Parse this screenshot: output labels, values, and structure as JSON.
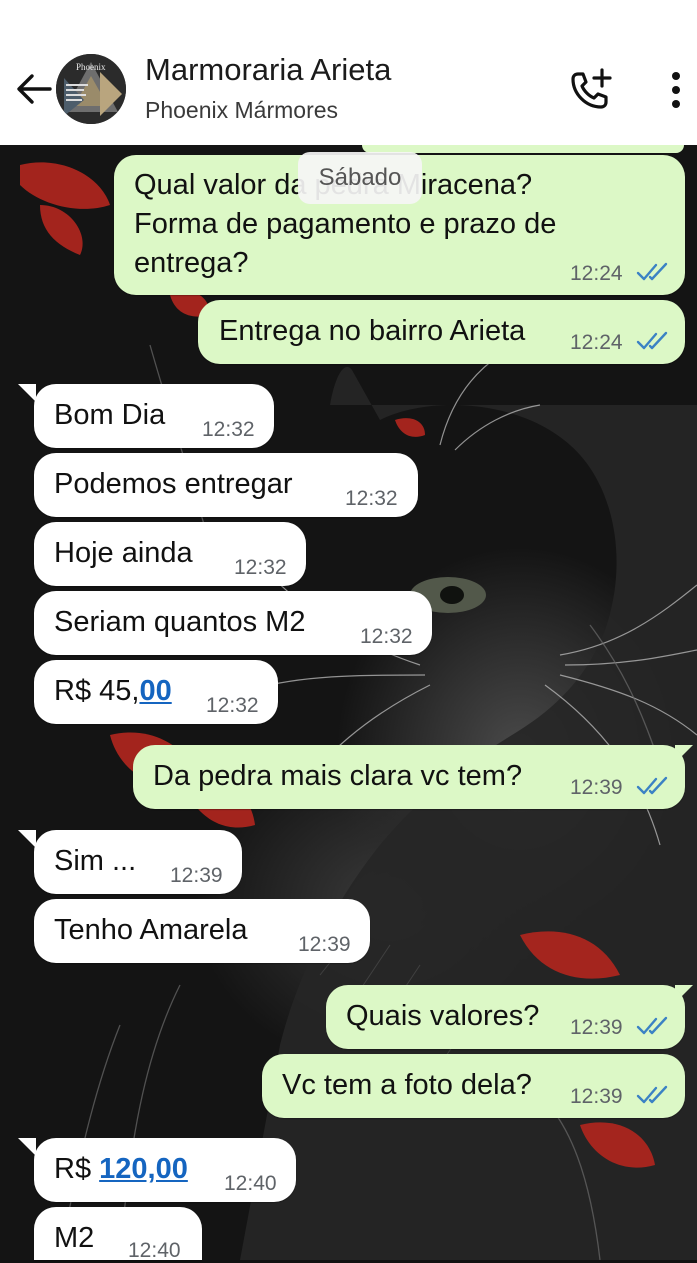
{
  "header": {
    "title": "Marmoraria Arieta",
    "subtitle": "Phoenix Mármores",
    "avatar_text": "Phoenix",
    "icons": {
      "back": "arrow-left-icon",
      "call": "add-call-icon",
      "menu": "more-vertical-icon"
    }
  },
  "date_chip": "Sábado",
  "messages": [
    {
      "dir": "out",
      "text_lines": [
        "Qual valor da pedra Miracena?",
        "Forma de pagamento e prazo de",
        "entrega?"
      ],
      "time": "12:24",
      "status": "read"
    },
    {
      "dir": "out",
      "text": "Entrega no bairro Arieta",
      "time": "12:24",
      "status": "read"
    },
    {
      "dir": "in",
      "text": "Bom Dia",
      "time": "12:32"
    },
    {
      "dir": "in",
      "text": "Podemos entregar",
      "time": "12:32"
    },
    {
      "dir": "in",
      "text": "Hoje ainda",
      "time": "12:32"
    },
    {
      "dir": "in",
      "text": "Seriam quantos M2",
      "time": "12:32"
    },
    {
      "dir": "in",
      "text_prefix": "R$ 45,",
      "text_link": "00",
      "time": "12:32"
    },
    {
      "dir": "out",
      "text": "Da pedra mais clara vc tem?",
      "time": "12:39",
      "status": "read"
    },
    {
      "dir": "in",
      "text": "Sim ...",
      "time": "12:39"
    },
    {
      "dir": "in",
      "text": "Tenho Amarela",
      "time": "12:39"
    },
    {
      "dir": "out",
      "text": "Quais valores?",
      "time": "12:39",
      "status": "read"
    },
    {
      "dir": "out",
      "text": "Vc tem a foto dela?",
      "time": "12:39",
      "status": "read"
    },
    {
      "dir": "in",
      "text_prefix": "R$ ",
      "text_link": "120,00",
      "time": "12:40"
    },
    {
      "dir": "in",
      "text": "M2",
      "time": "12:40"
    }
  ],
  "colors": {
    "outgoing_bubble": "#dcf8c6",
    "incoming_bubble": "#ffffff",
    "read_ticks": "#3b82c4",
    "link": "#1565c0"
  }
}
